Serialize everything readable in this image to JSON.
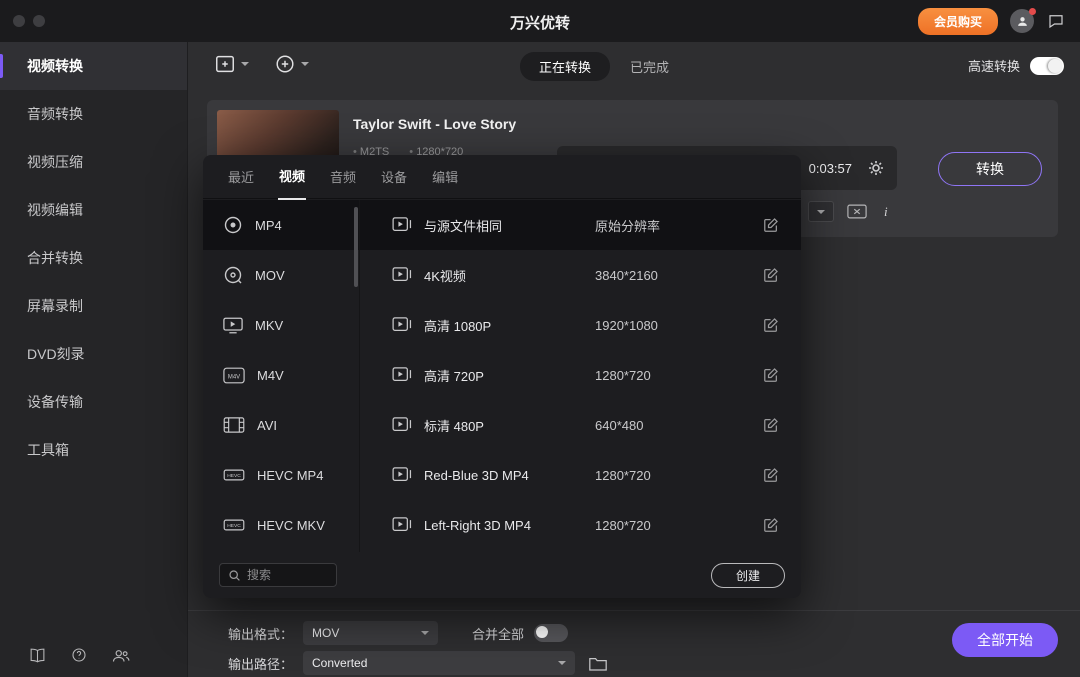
{
  "titlebar": {
    "title": "万兴优转",
    "buy_button": "会员购买"
  },
  "sidebar": {
    "items": [
      {
        "label": "视频转换",
        "active": true
      },
      {
        "label": "音频转换",
        "active": false
      },
      {
        "label": "视频压缩",
        "active": false
      },
      {
        "label": "视频编辑",
        "active": false
      },
      {
        "label": "合并转换",
        "active": false
      },
      {
        "label": "屏幕录制",
        "active": false
      },
      {
        "label": "DVD刻录",
        "active": false
      },
      {
        "label": "设备传输",
        "active": false
      },
      {
        "label": "工具箱",
        "active": false
      }
    ]
  },
  "toolbar": {
    "tabs": [
      {
        "label": "正在转换",
        "active": true
      },
      {
        "label": "已完成",
        "active": false
      }
    ],
    "high_speed_label": "高速转换",
    "high_speed_on": true
  },
  "task": {
    "title": "Taylor Swift - Love Story",
    "format": "M2TS",
    "resolution": "1280*720",
    "duration": "0:03:57",
    "convert_button": "转换",
    "info_glyph": "i"
  },
  "format_popup": {
    "tabs": [
      {
        "label": "最近",
        "active": false
      },
      {
        "label": "视频",
        "active": true
      },
      {
        "label": "音频",
        "active": false
      },
      {
        "label": "设备",
        "active": false
      },
      {
        "label": "编辑",
        "active": false
      }
    ],
    "formats": [
      {
        "name": "MP4",
        "active": true
      },
      {
        "name": "MOV",
        "active": false
      },
      {
        "name": "MKV",
        "active": false
      },
      {
        "name": "M4V",
        "active": false
      },
      {
        "name": "AVI",
        "active": false
      },
      {
        "name": "HEVC MP4",
        "active": false
      },
      {
        "name": "HEVC MKV",
        "active": false
      }
    ],
    "presets": [
      {
        "name": "与源文件相同",
        "resolution": "原始分辨率",
        "active": true
      },
      {
        "name": "4K视频",
        "resolution": "3840*2160",
        "active": false
      },
      {
        "name": "高清 1080P",
        "resolution": "1920*1080",
        "active": false
      },
      {
        "name": "高清 720P",
        "resolution": "1280*720",
        "active": false
      },
      {
        "name": "标清 480P",
        "resolution": "640*480",
        "active": false
      },
      {
        "name": "Red-Blue 3D MP4",
        "resolution": "1280*720",
        "active": false
      },
      {
        "name": "Left-Right 3D MP4",
        "resolution": "1280*720",
        "active": false
      }
    ],
    "search_placeholder": "搜索",
    "create_button": "创建"
  },
  "bottom": {
    "output_format_label": "输出格式：",
    "output_format_value": "MOV",
    "merge_label": "合并全部",
    "merge_on": false,
    "output_path_label": "输出路径：",
    "output_path_value": "Converted",
    "start_all_button": "全部开始"
  },
  "colors": {
    "accent": "#7c5af5",
    "orange": "#f5813a",
    "popup_bg": "#1d1d20",
    "card_bg": "#39393c"
  }
}
